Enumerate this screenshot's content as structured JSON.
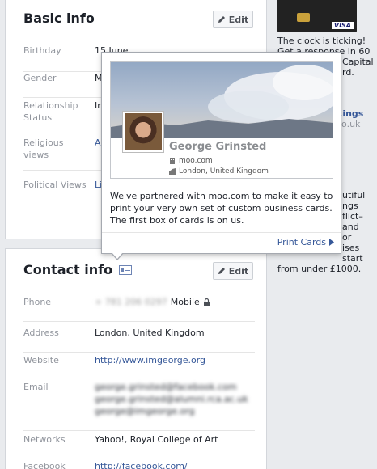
{
  "basic_info": {
    "title": "Basic info",
    "edit_label": "Edit",
    "rows": [
      {
        "label": "Birthday",
        "value": "15 June"
      },
      {
        "label": "Gender",
        "value": "M"
      },
      {
        "label": "Relationship Status",
        "value": "In"
      },
      {
        "label": "Religious views",
        "value": "A"
      },
      {
        "label": "Political Views",
        "value": "Li"
      }
    ]
  },
  "contact_info": {
    "title": "Contact info",
    "edit_label": "Edit",
    "phone": {
      "label": "Phone",
      "value": "+ 781 206 0297",
      "type": "Mobile"
    },
    "address": {
      "label": "Address",
      "value": "London, United Kingdom"
    },
    "website": {
      "label": "Website",
      "value": "http://www.imgeorge.org"
    },
    "email": {
      "label": "Email",
      "values": [
        "george.grinsted@facebook.com",
        "george.grinsted@alumni.rca.ac.uk",
        "george@imgeorge.org"
      ]
    },
    "networks": {
      "label": "Networks",
      "value": "Yahoo!, Royal College of Art"
    },
    "facebook": {
      "label": "Facebook",
      "value": "http://facebook.com/"
    }
  },
  "popover": {
    "card_name": "George Grinsted",
    "card_site": "moo.com",
    "card_location": "London, United Kingdom",
    "message": "We've partnered with moo.com to make it easy to print your very own set of custom business cards. The first box of cards is on us.",
    "action": "Print Cards"
  },
  "sidebar_ad": {
    "card_brand": "VISA",
    "text_lines": [
      "The clock is ticking!",
      "Get a response in 60",
      "Capital",
      "rd."
    ],
    "link_lines": [
      "kings",
      "co.uk"
    ],
    "text2_lines": [
      "utiful",
      "ngs",
      "flict–",
      "and",
      "or",
      "ises start",
      "from under £1000."
    ]
  },
  "colors": {
    "link": "#365899",
    "label": "#90949c",
    "background": "#e9ebee"
  }
}
